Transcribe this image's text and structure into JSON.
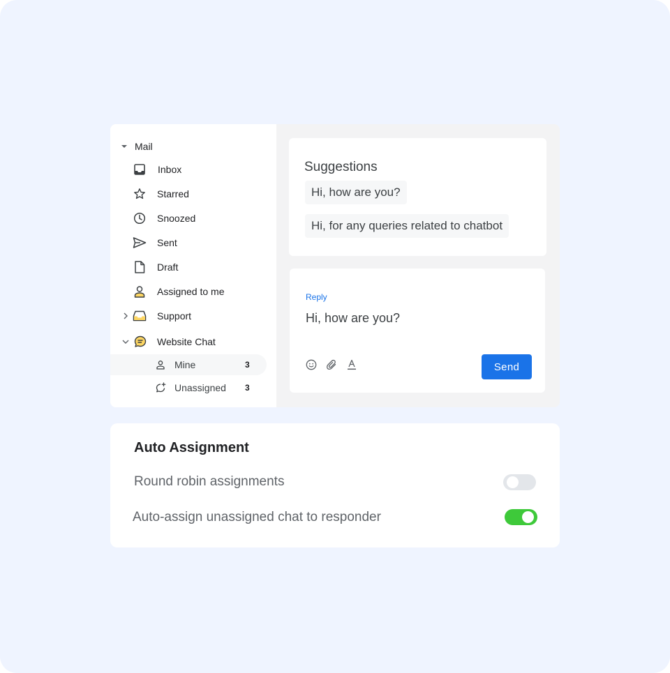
{
  "sidebar": {
    "section": "Mail",
    "items": [
      {
        "label": "Inbox",
        "icon": "inbox-icon"
      },
      {
        "label": "Starred",
        "icon": "star-icon"
      },
      {
        "label": "Snoozed",
        "icon": "clock-icon"
      },
      {
        "label": "Sent",
        "icon": "send-icon"
      },
      {
        "label": "Draft",
        "icon": "file-icon"
      },
      {
        "label": "Assigned to me",
        "icon": "person-icon"
      },
      {
        "label": "Support",
        "icon": "inbox-tray-icon"
      },
      {
        "label": "Website Chat",
        "icon": "chat-bubble-icon"
      }
    ],
    "sub_items": [
      {
        "label": "Mine",
        "count": "3",
        "icon": "person-outline-icon"
      },
      {
        "label": "Unassigned",
        "count": "3",
        "icon": "chat-add-icon"
      }
    ]
  },
  "suggestions": {
    "title": "Suggestions",
    "chips": [
      "Hi, how are you?",
      "Hi, for any queries related to chatbot"
    ]
  },
  "reply": {
    "label": "Reply",
    "text": "Hi, how are you?",
    "tools": [
      "emoji-icon",
      "attach-icon",
      "text-format-icon"
    ],
    "send_label": "Send"
  },
  "auto_assignment": {
    "title": "Auto Assignment",
    "options": [
      {
        "label": "Round robin assignments",
        "enabled": false
      },
      {
        "label": "Auto-assign unassigned chat to responder",
        "enabled": true
      }
    ]
  },
  "colors": {
    "background": "#eff4ff",
    "accent": "#1a73e8",
    "toggle_on": "#3ec93a",
    "toggle_off": "#e3e6ea",
    "icon_yellow": "#fdd663"
  }
}
